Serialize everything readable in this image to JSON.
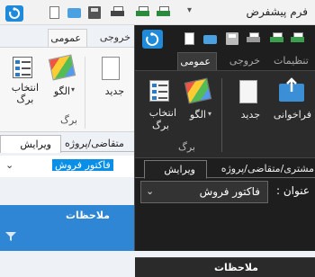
{
  "back_window": {
    "title": "فرم پیشفرض",
    "quick_access_arrow": "▾",
    "ribbon_tabs": [
      {
        "label": "عمومی",
        "selected": true
      },
      {
        "label": "خروجی",
        "selected": false
      }
    ],
    "buttons": {
      "new": "جدید",
      "pattern": "الگو",
      "pattern_arrow": "▾",
      "choose_sheet": "انتخاب\nبرگ"
    },
    "group_label": "برگ",
    "form_tabs": [
      {
        "label": "ویرایش",
        "selected": true
      },
      {
        "label": "متقاضی/پروژه",
        "selected": false
      }
    ],
    "title_field_value": "فاکتور فروش",
    "grid_header": "ملاحظات",
    "filter_icon": "filter"
  },
  "front_window": {
    "ribbon_tabs": [
      {
        "label": "تنظیمات",
        "selected": false
      },
      {
        "label": "خروجی",
        "selected": false
      },
      {
        "label": "عمومی",
        "selected": true
      }
    ],
    "buttons": {
      "receive": "فراخوانی",
      "new": "جدید",
      "pattern": "الگو",
      "pattern_arrow": "▾",
      "choose_sheet_line1": "انتخاب",
      "choose_sheet_line2": "برگ"
    },
    "group_label": "برگ",
    "form_tabs": [
      {
        "label": "ویرایش",
        "selected": true
      },
      {
        "label": "مشتری/متقاضی/پروژه",
        "selected": false
      }
    ],
    "title_label": "عنوان :",
    "title_field_value": "فاکتور فروش",
    "grid_header": "ملاحظات"
  },
  "colors": {
    "accent_blue": "#1f8ad9",
    "dark_background": "#1e1e1e",
    "selection_highlight": "#0a8fe8",
    "grid_header_light": "#2e86d4",
    "grid_header_dark": "#2a2a2a"
  }
}
